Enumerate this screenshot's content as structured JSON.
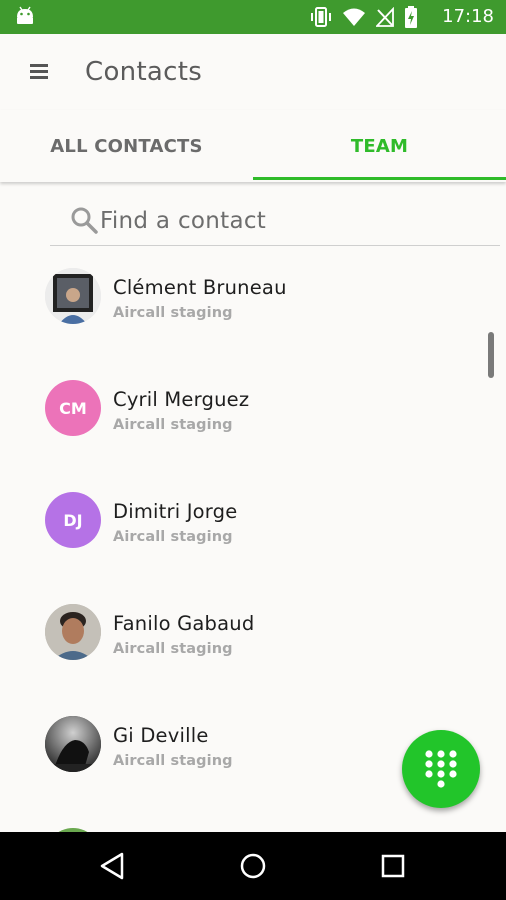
{
  "status_bar": {
    "time": "17:18",
    "icons": [
      "android-icon",
      "vibrate-icon",
      "wifi-icon",
      "no-signal-icon",
      "battery-charging-icon"
    ]
  },
  "app_bar": {
    "title": "Contacts",
    "menu_icon": "menu-icon"
  },
  "tabs": [
    {
      "label": "ALL CONTACTS",
      "active": false
    },
    {
      "label": "TEAM",
      "active": true
    }
  ],
  "search": {
    "placeholder": "Find a contact",
    "icon": "search-icon"
  },
  "contacts": [
    {
      "name": "Clément Bruneau",
      "subtitle": "Aircall staging",
      "avatar_type": "photo"
    },
    {
      "name": "Cyril Merguez",
      "subtitle": "Aircall staging",
      "avatar_type": "initials",
      "initials": "CM",
      "color": "#ec73b9"
    },
    {
      "name": "Dimitri Jorge",
      "subtitle": "Aircall staging",
      "avatar_type": "initials",
      "initials": "DJ",
      "color": "#b572e6"
    },
    {
      "name": "Fanilo Gabaud",
      "subtitle": "Aircall staging",
      "avatar_type": "photo"
    },
    {
      "name": "Gi Deville",
      "subtitle": "Aircall staging",
      "avatar_type": "photo"
    }
  ],
  "fab": {
    "icon": "dialpad-icon"
  },
  "nav_bar": {
    "buttons": [
      "back-icon",
      "home-icon",
      "recents-icon"
    ]
  },
  "colors": {
    "status_bar": "#3f9a2e",
    "accent": "#2fbb2a",
    "fab": "#22c52a"
  }
}
